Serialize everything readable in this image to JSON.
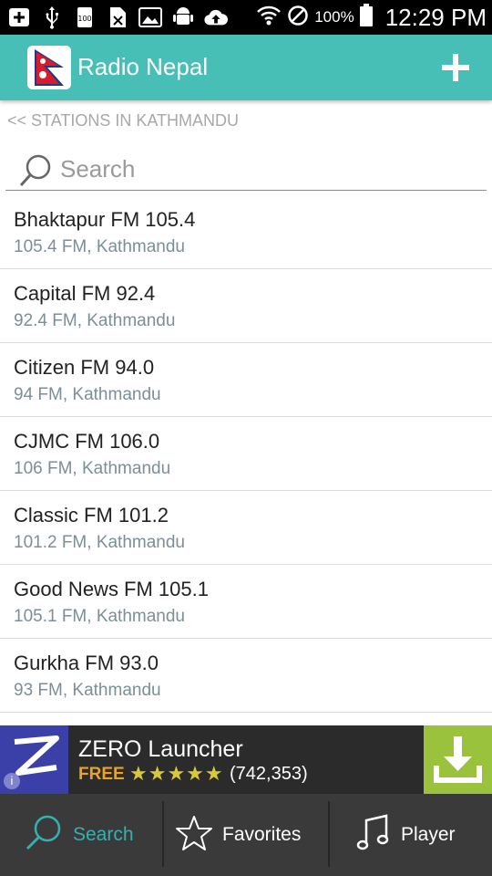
{
  "status_bar": {
    "battery_percent": "100%",
    "time": "12:29 PM"
  },
  "app_bar": {
    "title": "Radio Nepal"
  },
  "breadcrumb": "<< STATIONS IN KATHMANDU",
  "search": {
    "placeholder": "Search",
    "value": ""
  },
  "stations": [
    {
      "name": "Bhaktapur FM 105.4",
      "sub": "105.4 FM, Kathmandu"
    },
    {
      "name": "Capital FM 92.4",
      "sub": "92.4 FM, Kathmandu"
    },
    {
      "name": "Citizen FM 94.0",
      "sub": "94 FM, Kathmandu"
    },
    {
      "name": "CJMC FM 106.0",
      "sub": "106 FM, Kathmandu"
    },
    {
      "name": "Classic FM 101.2",
      "sub": "101.2 FM, Kathmandu"
    },
    {
      "name": "Good News FM 105.1",
      "sub": "105.1 FM, Kathmandu"
    },
    {
      "name": "Gurkha FM 93.0",
      "sub": "93 FM, Kathmandu"
    }
  ],
  "ad": {
    "title": "ZERO Launcher",
    "free_label": "FREE",
    "rating_stars": "★★★★★",
    "rating_count": "(742,353)"
  },
  "bottom_nav": {
    "search": "Search",
    "favorites": "Favorites",
    "player": "Player"
  },
  "colors": {
    "accent": "#47bfb6",
    "active_tab": "#35b0b0",
    "nav_bg": "#3a3a3a"
  }
}
